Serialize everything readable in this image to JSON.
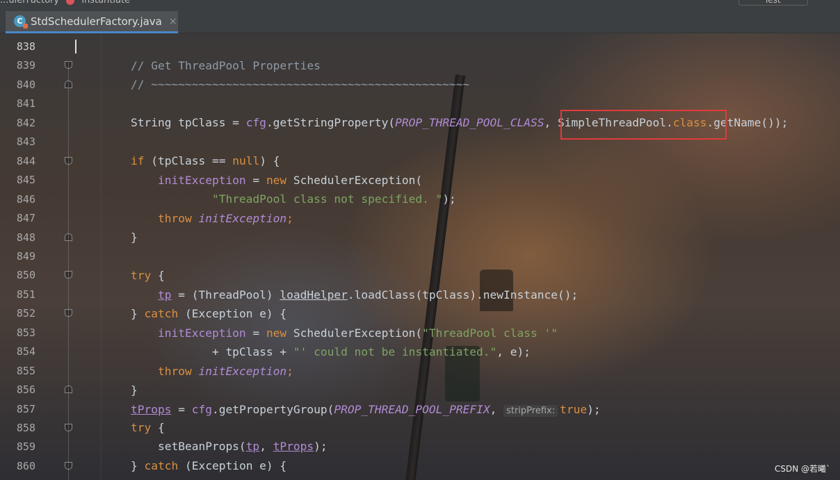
{
  "window": {
    "breadcrumb": [
      "...ulerFactory",
      "instantiate"
    ],
    "run_config": "Test"
  },
  "tab": {
    "label": "StdSchedulerFactory.java",
    "close": "×",
    "icon_letter": "C"
  },
  "editor": {
    "lines": [
      {
        "n": "838",
        "current": true
      },
      {
        "n": "839",
        "fold": "top"
      },
      {
        "n": "840",
        "fold": "bot"
      },
      {
        "n": "841"
      },
      {
        "n": "842"
      },
      {
        "n": "843"
      },
      {
        "n": "844",
        "fold": "top"
      },
      {
        "n": "845"
      },
      {
        "n": "846"
      },
      {
        "n": "847"
      },
      {
        "n": "848",
        "fold": "bot"
      },
      {
        "n": "849"
      },
      {
        "n": "850",
        "fold": "top"
      },
      {
        "n": "851"
      },
      {
        "n": "852",
        "fold": "top"
      },
      {
        "n": "853"
      },
      {
        "n": "854"
      },
      {
        "n": "855"
      },
      {
        "n": "856",
        "fold": "bot"
      },
      {
        "n": "857"
      },
      {
        "n": "858",
        "fold": "top"
      },
      {
        "n": "859"
      },
      {
        "n": "860",
        "fold": "top"
      }
    ],
    "code": {
      "l839": "// Get ThreadPool Properties",
      "l840": "// ~~~~~~~~~~~~~~~~~~~~~~~~~~~~~~~~~~~~~~~~~~~~~~~",
      "l842": {
        "t1": "String tpClass = ",
        "t2": "cfg",
        "t3": ".getStringProperty(",
        "t4": "PROP_THREAD_POOL_CLASS",
        "t5": ", ",
        "t6": "SimpleThreadPool.",
        "t7": "class",
        "t8": ".getName());"
      },
      "l844": {
        "t1": "if",
        "t2": " (tpClass == ",
        "t3": "null",
        "t4": ") {"
      },
      "l845": {
        "t1": "    ",
        "t2": "initException",
        "t3": " = ",
        "t4": "new",
        "t5": " SchedulerException("
      },
      "l846": {
        "t1": "            ",
        "t2": "\"ThreadPool class not specified. \"",
        "t3": ");"
      },
      "l847": {
        "t1": "    ",
        "t2": "throw",
        "t3": " ",
        "t4": "initException",
        "t5": ";"
      },
      "l848": "}",
      "l850": {
        "t1": "try",
        "t2": " {"
      },
      "l851": {
        "t1": "    ",
        "t2": "tp",
        "t3": " = (ThreadPool) ",
        "t4": "loadHelper",
        "t5": ".loadClass(tpClass).newInstance();"
      },
      "l852": {
        "t1": "} ",
        "t2": "catch",
        "t3": " (Exception e) {"
      },
      "l853": {
        "t1": "    ",
        "t2": "initException",
        "t3": " = ",
        "t4": "new",
        "t5": " SchedulerException(",
        "t6": "\"ThreadPool class '\""
      },
      "l854": {
        "t1": "            + tpClass + ",
        "t2": "\"' could not be instantiated.\"",
        "t3": ", e);"
      },
      "l855": {
        "t1": "    ",
        "t2": "throw",
        "t3": " ",
        "t4": "initException",
        "t5": ";"
      },
      "l856": "}",
      "l857": {
        "t1": "tProps",
        "t2": " = ",
        "t3": "cfg",
        "t4": ".getPropertyGroup(",
        "t5": "PROP_THREAD_POOL_PREFIX",
        "t6": ", ",
        "hint": "stripPrefix:",
        "t7": "true",
        "t8": ");"
      },
      "l858": {
        "t1": "try",
        "t2": " {"
      },
      "l859": {
        "t1": "    setBeanProps(",
        "t2": "tp",
        "t3": ", ",
        "t4": "tProps",
        "t5": ");"
      },
      "l860": {
        "t1": "} ",
        "t2": "catch",
        "t3": " (Exception e) {"
      }
    }
  },
  "watermark": "CSDN @若曦`",
  "colors": {
    "keyword": "#d98f42",
    "string": "#7ea464",
    "constant": "#b18cd6",
    "comment": "#8e9aa6",
    "highlight_box": "#e23b3b",
    "tab_underline": "#4a88c7"
  }
}
